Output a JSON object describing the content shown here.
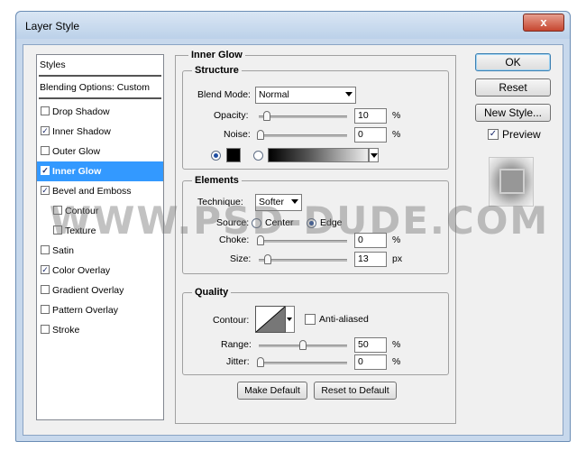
{
  "window": {
    "title": "Layer Style",
    "close_label": "x"
  },
  "styles_list": {
    "header": "Styles",
    "blending": "Blending Options: Custom",
    "items": [
      {
        "label": "Drop Shadow",
        "checked": false
      },
      {
        "label": "Inner Shadow",
        "checked": true
      },
      {
        "label": "Outer Glow",
        "checked": false
      },
      {
        "label": "Inner Glow",
        "checked": true,
        "selected": true
      },
      {
        "label": "Bevel and Emboss",
        "checked": true
      },
      {
        "label": "Contour",
        "checked": false
      },
      {
        "label": "Texture",
        "checked": false
      },
      {
        "label": "Satin",
        "checked": false
      },
      {
        "label": "Color Overlay",
        "checked": true
      },
      {
        "label": "Gradient Overlay",
        "checked": false
      },
      {
        "label": "Pattern Overlay",
        "checked": false
      },
      {
        "label": "Stroke",
        "checked": false
      }
    ]
  },
  "inner_glow": {
    "title": "Inner Glow",
    "structure": {
      "title": "Structure",
      "blend_mode_label": "Blend Mode:",
      "blend_mode_value": "Normal",
      "opacity_label": "Opacity:",
      "opacity_value": "10",
      "opacity_unit": "%",
      "noise_label": "Noise:",
      "noise_value": "0",
      "noise_unit": "%"
    },
    "elements": {
      "title": "Elements",
      "technique_label": "Technique:",
      "technique_value": "Softer",
      "source_label": "Source:",
      "source_center": "Center",
      "source_edge": "Edge",
      "source_selected": "Edge",
      "choke_label": "Choke:",
      "choke_value": "0",
      "choke_unit": "%",
      "size_label": "Size:",
      "size_value": "13",
      "size_unit": "px"
    },
    "quality": {
      "title": "Quality",
      "contour_label": "Contour:",
      "anti_aliased_label": "Anti-aliased",
      "anti_aliased": false,
      "range_label": "Range:",
      "range_value": "50",
      "range_unit": "%",
      "jitter_label": "Jitter:",
      "jitter_value": "0",
      "jitter_unit": "%"
    },
    "make_default": "Make Default",
    "reset_default": "Reset to Default"
  },
  "buttons": {
    "ok": "OK",
    "reset": "Reset",
    "new_style": "New Style...",
    "preview_label": "Preview",
    "preview_checked": true
  },
  "watermark": "WWW.PSD-DUDE.COM",
  "colors": {
    "selection": "#3399ff",
    "dialog_bg": "#f0f0f0",
    "frame": "#c7d8ec"
  }
}
